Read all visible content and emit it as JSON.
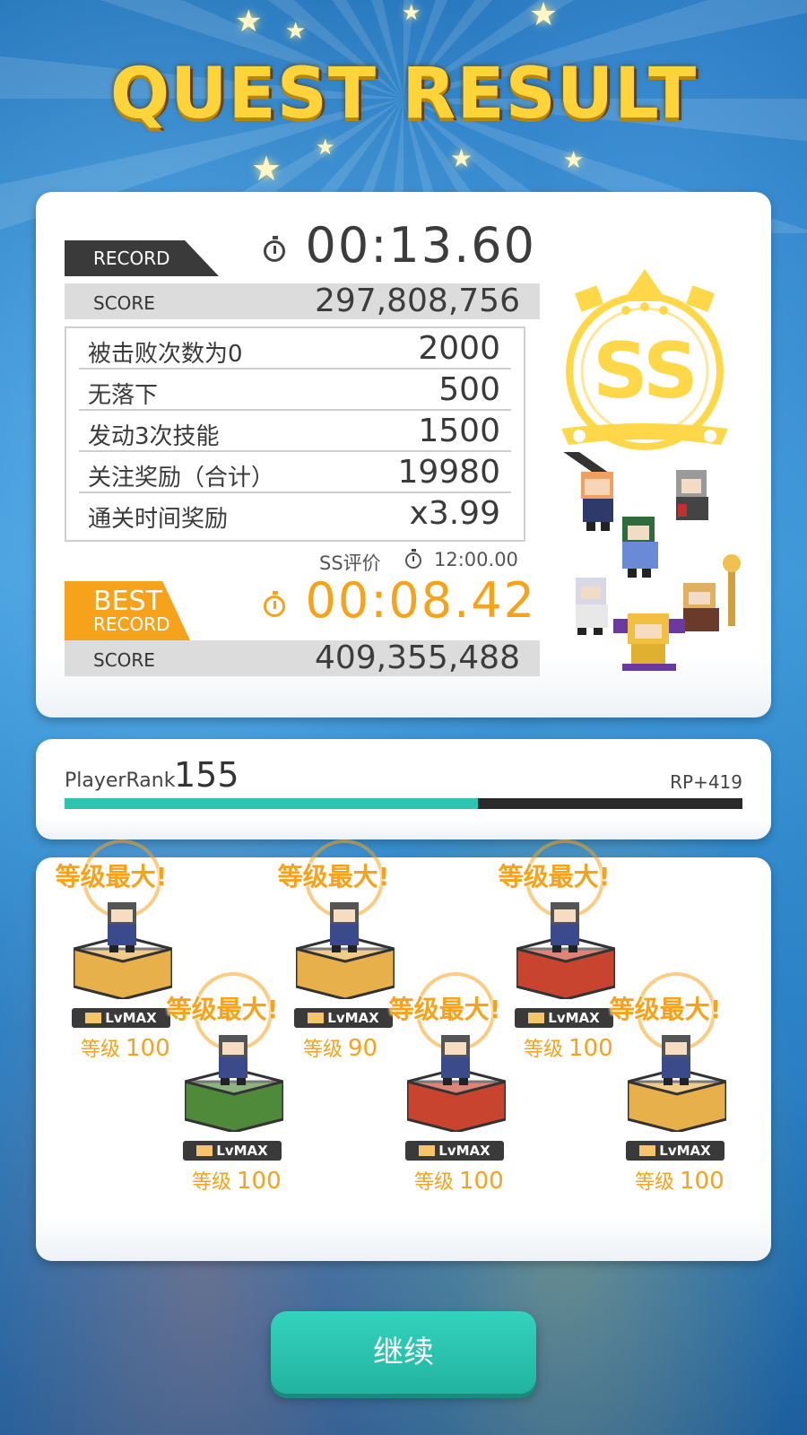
{
  "title": "QUEST RESULT",
  "record": {
    "tag": "RECORD",
    "time": "00:13.60",
    "score_label": "SCORE",
    "score": "297,808,756"
  },
  "bonuses": [
    {
      "name": "被击败次数为0",
      "value": "2000"
    },
    {
      "name": "无落下",
      "value": "500"
    },
    {
      "name": "发动3次技能",
      "value": "1500"
    },
    {
      "name": "关注奖励（合计）",
      "value": "19980"
    },
    {
      "name": "通关时间奖励",
      "value": "x3.99"
    }
  ],
  "ss_requirement": {
    "label": "SS评价",
    "time": "12:00.00"
  },
  "best": {
    "tag_line1": "BEST",
    "tag_line2": "RECORD",
    "time": "00:08.42",
    "score_label": "SCORE",
    "score": "409,355,488"
  },
  "grade": "SS",
  "player_rank": {
    "label": "PlayerRank",
    "value": "155",
    "rp": "RP+419",
    "progress": 0.61
  },
  "units": [
    {
      "banner": "等级最大!",
      "tag": "LvMAX",
      "level_label": "等级",
      "level": "100",
      "base_color": "#e8b04a"
    },
    {
      "banner": "等级最大!",
      "tag": "LvMAX",
      "level_label": "等级",
      "level": "100",
      "base_color": "#4f8a3a"
    },
    {
      "banner": "等级最大!",
      "tag": "LvMAX",
      "level_label": "等级",
      "level": "90",
      "base_color": "#e8b04a"
    },
    {
      "banner": "等级最大!",
      "tag": "LvMAX",
      "level_label": "等级",
      "level": "100",
      "base_color": "#c9442e"
    },
    {
      "banner": "等级最大!",
      "tag": "LvMAX",
      "level_label": "等级",
      "level": "100",
      "base_color": "#c9442e"
    },
    {
      "banner": "等级最大!",
      "tag": "LvMAX",
      "level_label": "等级",
      "level": "100",
      "base_color": "#e8b04a"
    }
  ],
  "continue_label": "继续",
  "colors": {
    "accent": "#f7a21b",
    "teal": "#2dc5b0",
    "gold": "#ffd43a"
  }
}
